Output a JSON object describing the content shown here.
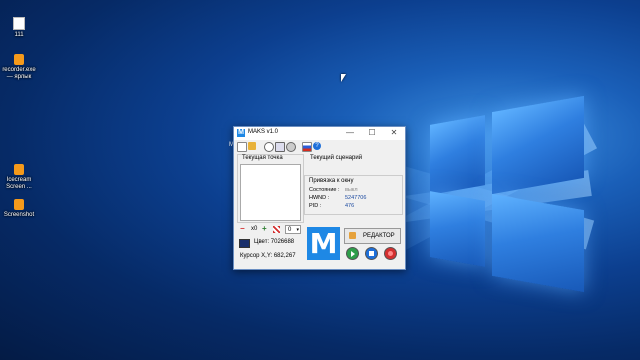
{
  "desktop": {
    "icons": [
      {
        "label": "111",
        "icon": "text-file-icon"
      },
      {
        "label": "recorder.exe — ярлык",
        "icon": "app-shortcut-icon"
      },
      {
        "label": "Icecream Screen ...",
        "icon": "app-shortcut-icon"
      },
      {
        "label": "Screenshot",
        "icon": "app-shortcut-icon"
      }
    ],
    "left_cut_text": "M"
  },
  "window": {
    "title": "MAKS v1.0",
    "logo_letter": "M",
    "controls": {
      "minimize": "—",
      "maximize": "☐",
      "close": "✕"
    },
    "current_point": {
      "title": "Текущая точка"
    },
    "current_scenario": {
      "title": "Текущий сценарий"
    },
    "binding": {
      "title": "Привязка к окну",
      "state_label": "Состояние :",
      "state_value": "выкл",
      "hwnd_label": "HWND :",
      "hwnd_value": "5247706",
      "pid_label": "PID :",
      "pid_value": "476"
    },
    "point_controls": {
      "remove": "−",
      "multiplier": "x0",
      "add": "+",
      "count_value": "0"
    },
    "color_label": "Цвет: 7026688",
    "cursor_label": "Курсор X,Y: 682,267",
    "big_logo": "M",
    "editor_button": "РЕДАКТОР",
    "colors": {
      "accent": "#1e88e5",
      "swatch": "#1a2f6b"
    }
  }
}
